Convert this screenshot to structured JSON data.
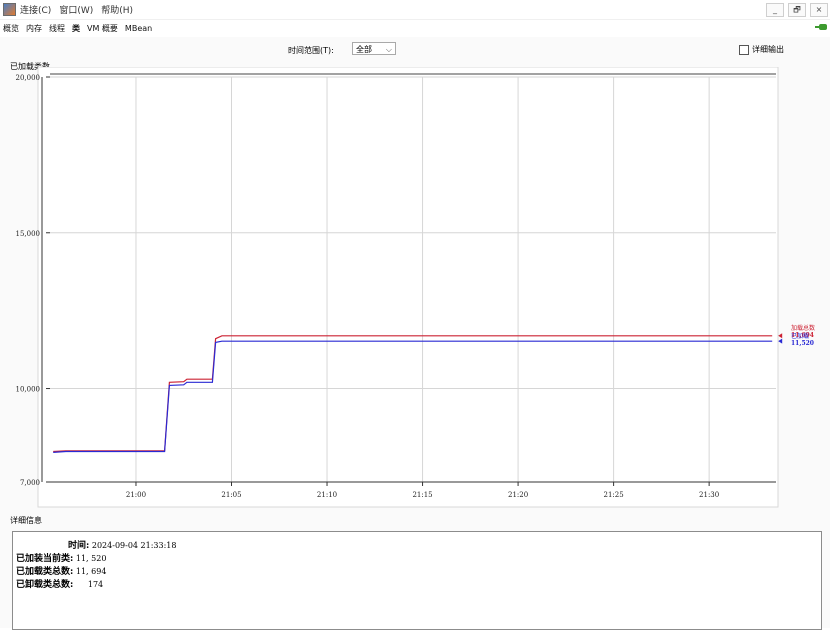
{
  "menu": [
    "连接(C)",
    "窗口(W)",
    "帮助(H)"
  ],
  "window_controls": [
    "_",
    "🗗",
    "×"
  ],
  "tabs": [
    "概览",
    "内存",
    "线程",
    "类",
    "VM 概要",
    "MBean"
  ],
  "active_tab": "类",
  "time_range": {
    "label": "时间范围(T):",
    "value": "全部"
  },
  "detail_output": {
    "label": "详细输出",
    "checked": false
  },
  "chart_data": {
    "type": "line",
    "title": "已加载类数",
    "y_ticks": [
      "20,000",
      "15,000",
      "10,000",
      "7,000"
    ],
    "x_ticks": [
      "21:00",
      "21:05",
      "21:10",
      "21:15",
      "21:20",
      "21:25",
      "21:30"
    ],
    "ylim": [
      7000,
      20000
    ],
    "xlim": [
      "20:55:30",
      "21:33:30"
    ],
    "grid": true,
    "series": [
      {
        "name": "加载总数",
        "color": "#cc2233",
        "label_value": "11,694",
        "points": [
          [
            "20:55:40",
            7980
          ],
          [
            "20:56:20",
            8000
          ],
          [
            "21:01:30",
            8000
          ],
          [
            "21:01:45",
            10200
          ],
          [
            "21:02:30",
            10220
          ],
          [
            "21:02:40",
            10300
          ],
          [
            "21:04:00",
            10300
          ],
          [
            "21:04:10",
            11600
          ],
          [
            "21:04:30",
            11694
          ],
          [
            "21:33:18",
            11694
          ]
        ]
      },
      {
        "name": "已加载",
        "color": "#2a2ad4",
        "label_value": "11,520",
        "points": [
          [
            "20:55:40",
            7950
          ],
          [
            "20:56:20",
            7980
          ],
          [
            "21:01:30",
            7980
          ],
          [
            "21:01:45",
            10100
          ],
          [
            "21:02:30",
            10120
          ],
          [
            "21:02:40",
            10200
          ],
          [
            "21:04:00",
            10200
          ],
          [
            "21:04:10",
            11480
          ],
          [
            "21:04:30",
            11520
          ],
          [
            "21:33:18",
            11520
          ]
        ]
      }
    ]
  },
  "details": {
    "title": "详细信息",
    "rows": [
      {
        "label": "时间:",
        "value": "2024-09-04 21:33:18"
      },
      {
        "label": "已加装当前类:",
        "value": "11, 520"
      },
      {
        "label": "已加载类总数:",
        "value": "11, 694"
      },
      {
        "label": "已卸载类总数:",
        "value": "174"
      }
    ]
  }
}
